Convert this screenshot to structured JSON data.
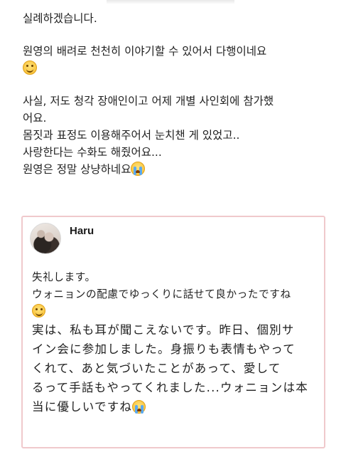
{
  "post": {
    "p1": [
      "실례하겠습니다."
    ],
    "p2": [
      "원영의 배려로 천천히 이야기할 수 있어서 다행이네요"
    ],
    "p3": [
      "사실, 저도 청각 장애인이고 어제 개별 사인회에 참가했",
      "어요.",
      "몸짓과 표정도 이용해주어서 눈치챈 게 있었고..",
      "사랑한다는 수화도 해줬어요...",
      "원영은 정말 상냥하네요"
    ]
  },
  "card": {
    "username": "Haru",
    "lines": [
      "失礼します。",
      "ウォニョンの配慮でゆっくりに話せて良かったですね",
      "実は、私も耳が聞こえないです。昨日、個別サ",
      "イン会に参加しました。身振りも表情もやって",
      "くれて、あと気づいたことがあって、愛して",
      "るって手話もやってくれました...ウォニョンは本",
      "当に優しいですね"
    ]
  },
  "emoji": {
    "smile": "smiling-face-emoji",
    "cry": "loudly-crying-face-emoji"
  },
  "colors": {
    "card_border": "#f0c9cc",
    "text": "#222222"
  }
}
